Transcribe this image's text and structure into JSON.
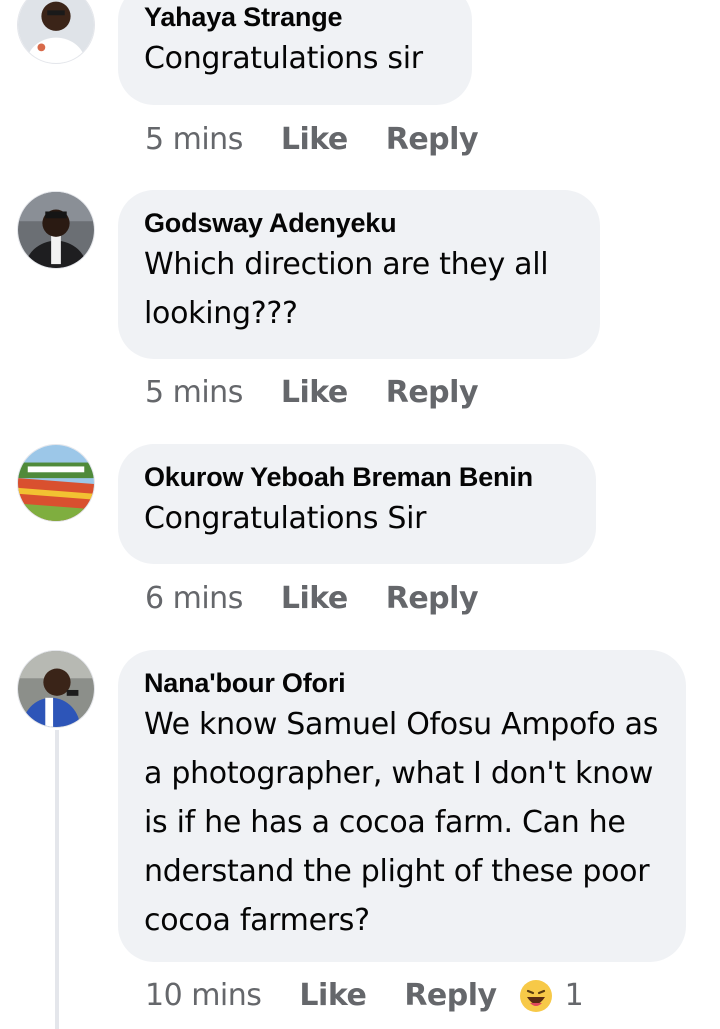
{
  "comments": [
    {
      "author": "Yahaya Strange",
      "text": "Congratulations sir",
      "time": "5 mins",
      "like_label": "Like",
      "reply_label": "Reply"
    },
    {
      "author": "Godsway Adenyeku",
      "text": "Which direction are they all looking???",
      "time": "5 mins",
      "like_label": "Like",
      "reply_label": "Reply"
    },
    {
      "author": "Okurow Yeboah Breman Benin",
      "text": "Congratulations Sir",
      "time": "6 mins",
      "like_label": "Like",
      "reply_label": "Reply"
    },
    {
      "author": "Nana'bour Ofori",
      "text": "We know Samuel Ofosu Ampofo as a photographer, what I don't know is if he has a cocoa farm. Can he nderstand the plight of these poor cocoa farmers?",
      "time": "10 mins",
      "like_label": "Like",
      "reply_label": "Reply",
      "reaction_icon": "laughing-emoji-icon",
      "reaction_count": "1"
    }
  ],
  "colors": {
    "bubble": "#f0f2f5",
    "meta_text": "#65676b",
    "primary_text": "#050505"
  }
}
